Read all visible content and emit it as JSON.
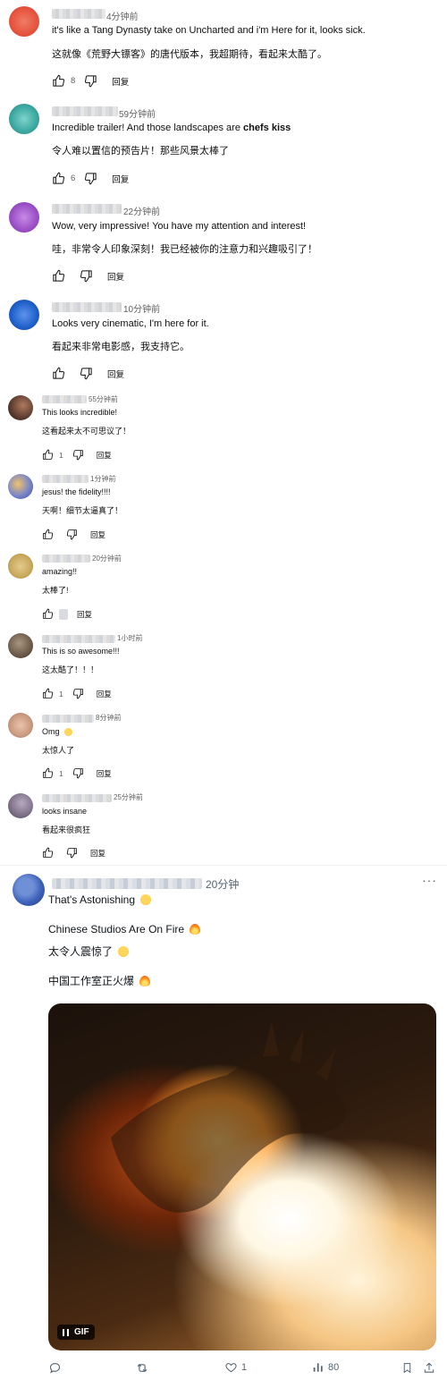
{
  "comments": [
    {
      "time": "4分钟前",
      "text": "it's like a Tang Dynasty take on Uncharted and i'm Here for it, looks sick.",
      "translation": "这就像《荒野大镖客》的唐代版本，我超期待，看起来太酷了。",
      "likes": "8",
      "reply": "回复",
      "avatar_color": "#e5533d"
    },
    {
      "time": "59分钟前",
      "text": "Incredible trailer! And those landscapes are",
      "text_bold": "chefs kiss",
      "translation": "令人难以置信的预告片！那些风景太棒了",
      "likes": "6",
      "reply": "回复",
      "avatar_color": "#3aa8a0"
    },
    {
      "time": "22分钟前",
      "text": "Wow, very impressive! You have my attention and interest!",
      "translation": "哇，非常令人印象深刻！我已经被你的注意力和兴趣吸引了！",
      "likes": "",
      "reply": "回复",
      "avatar_color": "#9b4fc7"
    },
    {
      "time": "10分钟前",
      "text": "Looks very cinematic, I'm here for it.",
      "translation": "看起来非常电影感，我支持它。",
      "likes": "",
      "reply": "回复",
      "avatar_color": "#1e5fc9"
    },
    {
      "time": "55分钟前",
      "text": "This looks incredible!",
      "translation": "这看起来太不可思议了！",
      "likes": "1",
      "reply": "回复",
      "avatar_color": "#5a3a2e"
    },
    {
      "time": "1分钟前",
      "text": "jesus! the fidelity!!!!",
      "translation": "天啊！细节太逼真了！",
      "likes": "",
      "reply": "回复",
      "avatar_color": "#7a86c9"
    },
    {
      "time": "20分钟前",
      "text": "amazing!!",
      "translation": "太棒了!",
      "likes": "",
      "reply": "回复",
      "avatar_color": "#c9a85c"
    },
    {
      "time": "1小时前",
      "text": "This is so awesome!!!",
      "translation": "这太酷了！！！",
      "likes": "1",
      "reply": "回复",
      "avatar_color": "#6b5a49"
    },
    {
      "time": "8分钟前",
      "text": "Omg",
      "translation": "太惊人了",
      "likes": "1",
      "reply": "回复",
      "avatar_color": "#c99a7f"
    },
    {
      "time": "25分钟前",
      "text": "looks insane",
      "translation": "看起来很疯狂",
      "likes": "",
      "reply": "回复",
      "avatar_color": "#7c6f86"
    }
  ],
  "x_post": {
    "time": "20分钟",
    "more": "···",
    "line1": "That's Astonishing",
    "line2": "Chinese Studios Are On Fire",
    "line3": "太令人震惊了",
    "line4": "中国工作室正火爆",
    "gif_label": "GIF",
    "likes": "1",
    "views": "80"
  }
}
